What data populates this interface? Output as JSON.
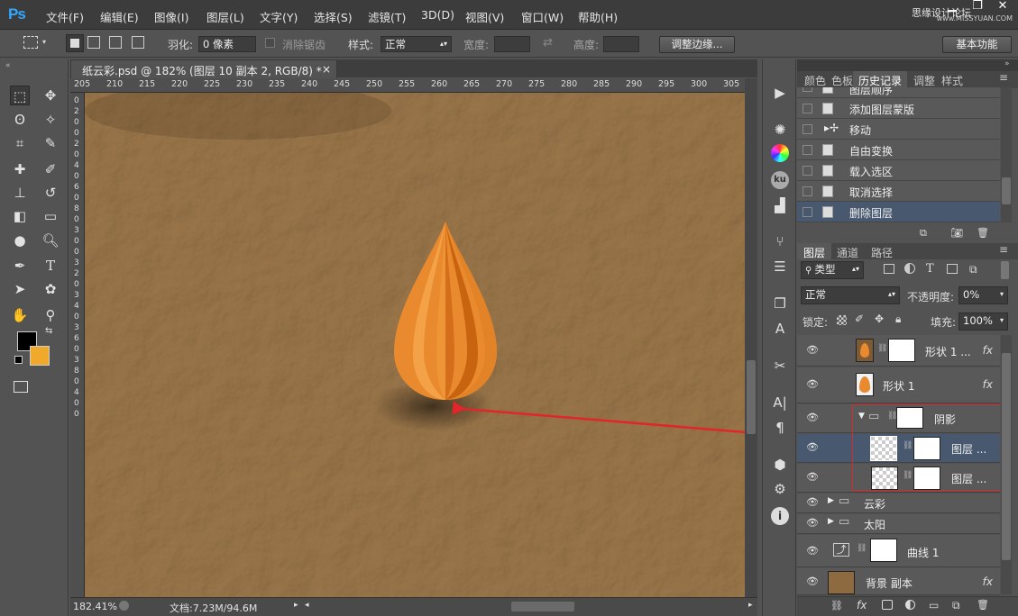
{
  "app": {
    "logo": "Ps"
  },
  "menu": [
    "文件(F)",
    "编辑(E)",
    "图像(I)",
    "图层(L)",
    "文字(Y)",
    "选择(S)",
    "滤镜(T)",
    "3D(D)",
    "视图(V)",
    "窗口(W)",
    "帮助(H)"
  ],
  "watermark": {
    "main": "思缘设计论坛",
    "url": "www.MISSYUAN.COM"
  },
  "options": {
    "feather_label": "羽化:",
    "feather_value": "0 像素",
    "antialias_label": "消除锯齿",
    "style_label": "样式:",
    "style_value": "正常",
    "width_label": "宽度:",
    "height_label": "高度:",
    "refine_edge_button": "调整边缘...",
    "workspace_button": "基本功能"
  },
  "document": {
    "tab_title": "纸云彩.psd @ 182% (图层 10 副本 2, RGB/8) *",
    "close_glyph": "×",
    "zoom": "182.41%",
    "doc_size": "文档:7.23M/94.6M",
    "ruler_h": [
      "205",
      "210",
      "215",
      "220",
      "225",
      "230",
      "235",
      "240",
      "245",
      "250",
      "255",
      "260",
      "265",
      "270",
      "275",
      "280",
      "285",
      "290",
      "295",
      "300",
      "305"
    ],
    "ruler_v": [
      "0",
      "2",
      "0",
      "0",
      "2",
      "0",
      "4",
      "0",
      "6",
      "0",
      "8",
      "0",
      "3",
      "0",
      "0",
      "3",
      "2",
      "0",
      "3",
      "4",
      "0",
      "3",
      "6",
      "0",
      "3",
      "8",
      "0",
      "4",
      "0",
      "0"
    ],
    "canvas_color": "#8e6a40"
  },
  "panels": {
    "top_tabs": [
      "颜色",
      "色板",
      "历史记录",
      "调整",
      "样式"
    ],
    "history": [
      "图层顺序",
      "添加图层蒙版",
      "移动",
      "自由变换",
      "载入选区",
      "取消选择",
      "删除图层"
    ],
    "layer_tabs": [
      "图层",
      "通道",
      "路径"
    ],
    "filter_kind": "类型",
    "blend_mode": "正常",
    "opacity_label": "不透明度:",
    "opacity_value": "0%",
    "lock_label": "锁定:",
    "fill_label": "填充:",
    "fill_value": "100%",
    "layers": [
      {
        "name": "形状 1 ...",
        "fx": "fx"
      },
      {
        "name": "形状 1",
        "fx": "fx"
      },
      {
        "name": "阴影"
      },
      {
        "name": "图层 ..."
      },
      {
        "name": "图层 ..."
      },
      {
        "name": "云彩"
      },
      {
        "name": "太阳"
      },
      {
        "name": "曲线 1"
      },
      {
        "name": "背景 副本",
        "fx": "fx"
      }
    ]
  },
  "colors": {
    "foreground": "#000000",
    "background": "#f0a92a",
    "highlight_box": "#e0262b",
    "drop_orange": "#e98a2e"
  }
}
